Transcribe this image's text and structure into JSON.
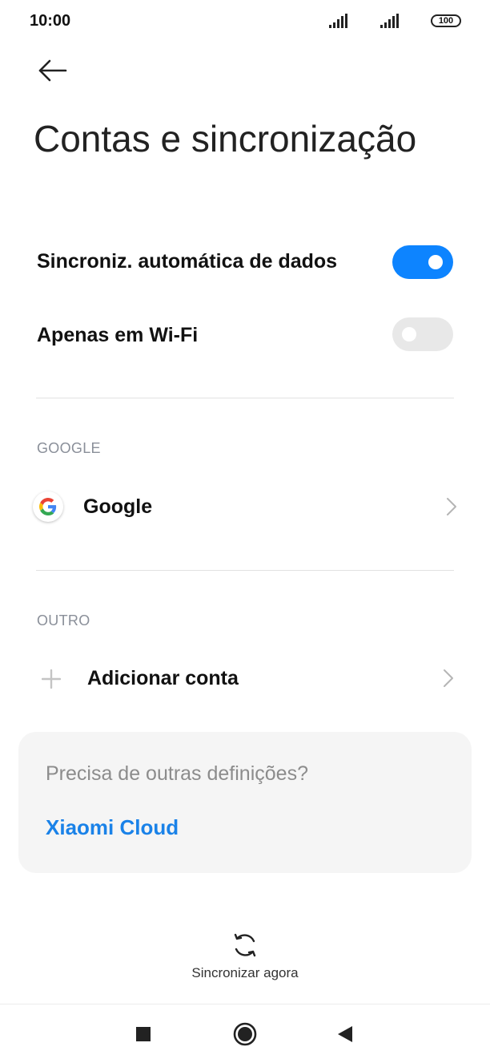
{
  "status_bar": {
    "time": "10:00",
    "battery": "100"
  },
  "header": {
    "title": "Contas e sincronização"
  },
  "settings": {
    "auto_sync_label": "Sincroniz. automática de dados",
    "auto_sync_enabled": true,
    "wifi_only_label": "Apenas em Wi-Fi",
    "wifi_only_enabled": false
  },
  "sections": {
    "google_header": "GOOGLE",
    "google_account_label": "Google",
    "other_header": "OUTRO",
    "add_account_label": "Adicionar conta"
  },
  "card": {
    "question": "Precisa de outras definições?",
    "link": "Xiaomi Cloud"
  },
  "sync_now": {
    "label": "Sincronizar agora"
  },
  "colors": {
    "accent": "#0d84ff",
    "link": "#1a82e8",
    "toggle_off": "#e8e8e8",
    "muted_text": "#8a8f99"
  },
  "icons": {
    "back": "arrow-left-icon",
    "google": "google-logo-icon",
    "chevron": "chevron-right-icon",
    "plus": "plus-icon",
    "sync": "sync-icon",
    "nav_recent": "square-icon",
    "nav_home": "circle-icon",
    "nav_back": "triangle-left-icon"
  }
}
